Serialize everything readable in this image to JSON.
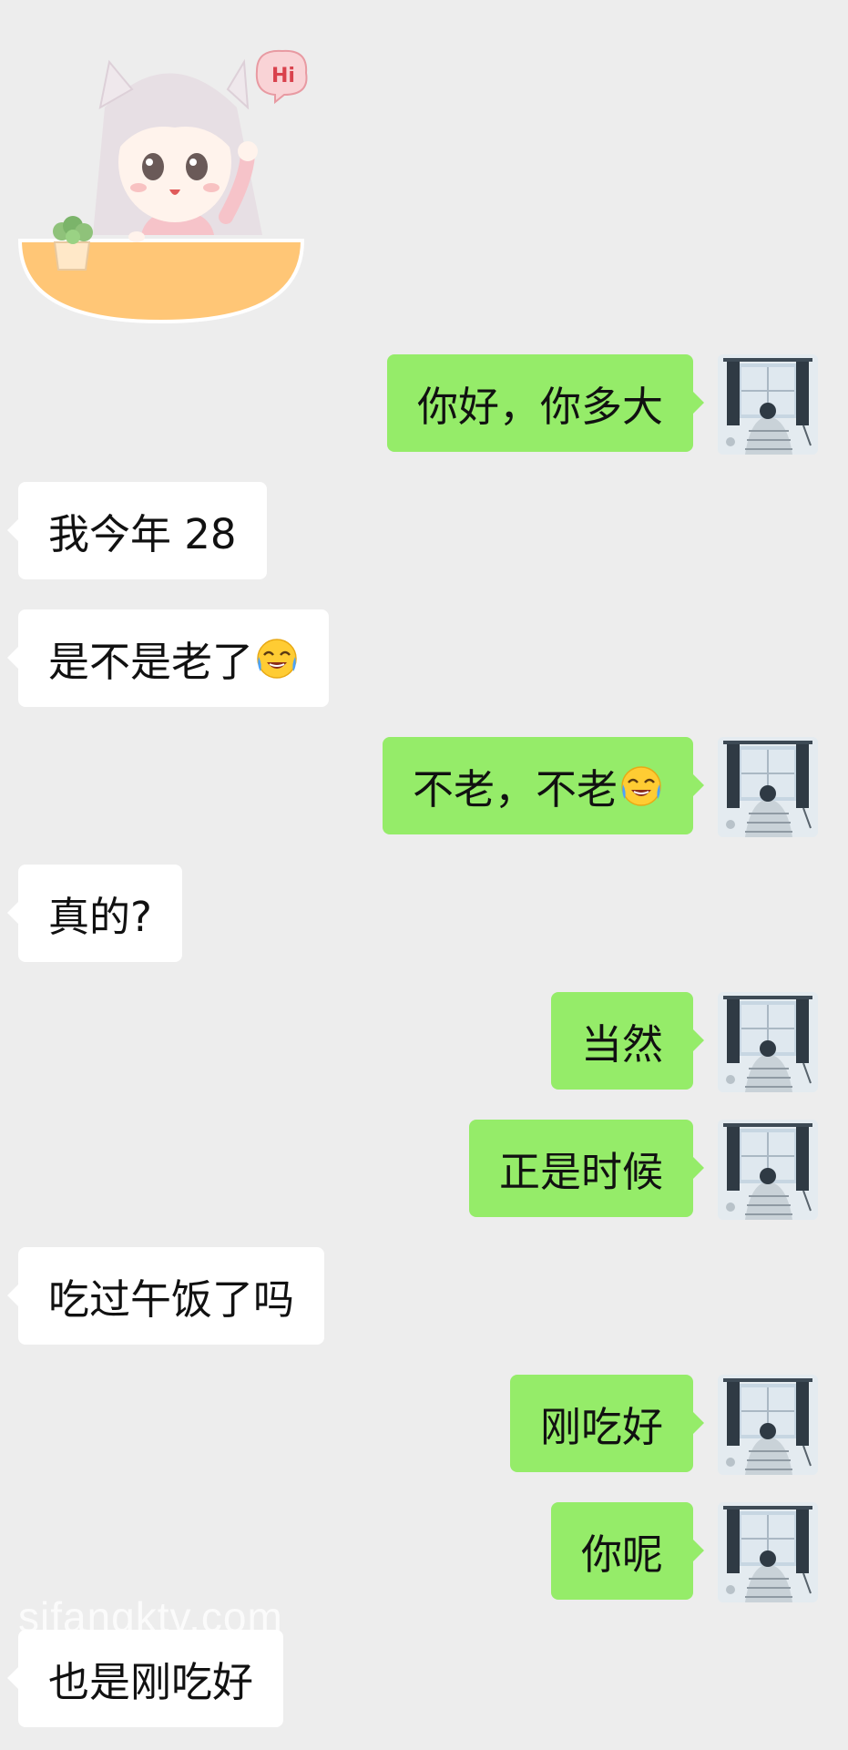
{
  "sticker": {
    "text": "Hi",
    "icon": "cartoon-girl-waving-sticker"
  },
  "messages": [
    {
      "side": "out",
      "text": "你好，你多大"
    },
    {
      "side": "in",
      "text": "我今年 28"
    },
    {
      "side": "in",
      "text": "是不是老了",
      "emoji": "face-with-tears-of-joy"
    },
    {
      "side": "out",
      "text": "不老，不老",
      "emoji": "face-with-tears-of-joy"
    },
    {
      "side": "in",
      "text": "真的?"
    },
    {
      "side": "out",
      "text": "当然"
    },
    {
      "side": "out",
      "text": "正是时候"
    },
    {
      "side": "in",
      "text": "吃过午饭了吗"
    },
    {
      "side": "out",
      "text": "刚吃好"
    },
    {
      "side": "out",
      "text": "你呢"
    },
    {
      "side": "in",
      "text": "也是刚吃好"
    }
  ],
  "watermark": "sifangktv.com",
  "colors": {
    "background": "#ededed",
    "outgoing_bubble": "#95ec69",
    "incoming_bubble": "#ffffff"
  },
  "avatar_icon": "window-scene-avatar"
}
